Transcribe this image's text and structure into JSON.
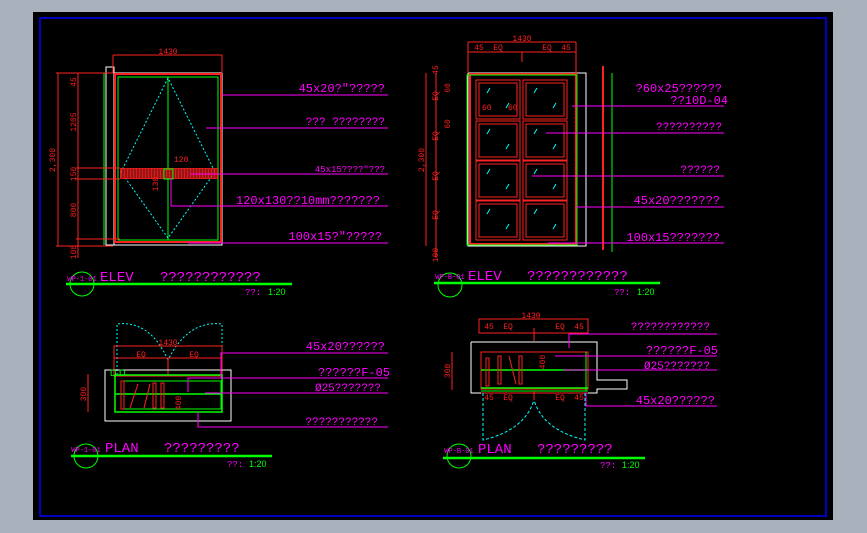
{
  "colors": {
    "background": "#000000",
    "frame": "#0000ff",
    "dim": "#ff2020",
    "outline": "#00ff00",
    "callout": "#ff00ff",
    "swing": "#00ffff",
    "edge": "#ffffff"
  },
  "elev1": {
    "width_dim": "1430",
    "height_dim": "2,300",
    "seg_dims": [
      "45",
      "1205",
      "150",
      "800",
      "100"
    ],
    "handle_dims": [
      "120",
      "130"
    ],
    "callouts": [
      "45x20?\"?????",
      "??? ????????",
      "45x15????\"???",
      "120x130??10mm???????",
      "100x15?\"?????"
    ],
    "tag": "WP-1-01",
    "title": "ELEV",
    "subtitle": "????????????",
    "scale": "??:",
    "scale_value": "1:20"
  },
  "elev2": {
    "width_dim": "1430",
    "top_dims": [
      "45",
      "EQ",
      "EQ",
      "45"
    ],
    "height_dim": "2,300",
    "seg_dims": [
      "45",
      "EQ",
      "EQ",
      "EQ",
      "EQ",
      "100"
    ],
    "panel_dims": [
      "60",
      "60",
      "60",
      "60"
    ],
    "callouts": [
      "?60x25??????",
      "??10D-04",
      "??????????",
      "??????",
      "45x20???????",
      "100x15???????"
    ],
    "tag": "WP-B-01",
    "title": "ELEV",
    "subtitle": "????????????",
    "scale": "??:",
    "scale_value": "1:20"
  },
  "plan1": {
    "width_dim": "1430",
    "eq_dims": [
      "EQ",
      "EQ"
    ],
    "depth_dim": "300",
    "inner_dim": "400",
    "small_dim": "D.D",
    "callouts": [
      "45x20??????",
      "??????F-05",
      "Ø25???????",
      "???????????"
    ],
    "tag": "WP-1-01",
    "title": "PLAN",
    "subtitle": "?????????",
    "scale": "??:",
    "scale_value": "1:20"
  },
  "plan2": {
    "width_dim": "1430",
    "top_dims": [
      "45",
      "EQ",
      "EQ",
      "45"
    ],
    "bottom_dims": [
      "45",
      "EQ",
      "EQ",
      "45"
    ],
    "depth_dim": "300",
    "inner_dim": "400",
    "callouts": [
      "????????????",
      "??????F-05",
      "Ø25???????",
      "45x20??????"
    ],
    "tag": "WP-B-01",
    "title": "PLAN",
    "subtitle": "?????????",
    "scale": "??:",
    "scale_value": "1:20"
  }
}
